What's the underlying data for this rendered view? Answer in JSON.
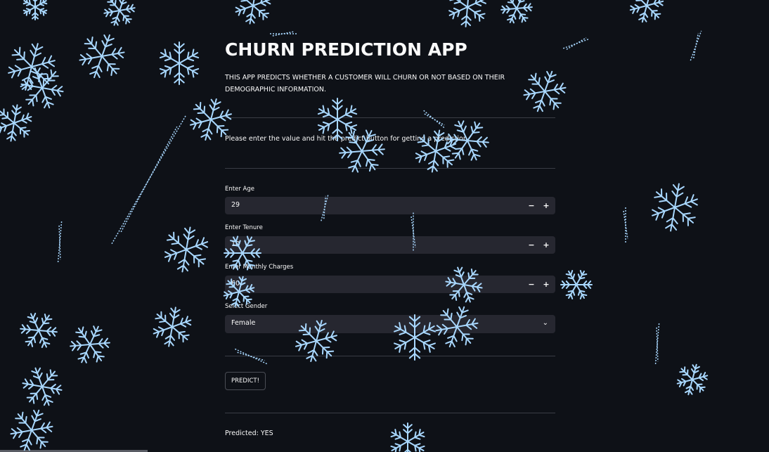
{
  "app": {
    "title": "CHURN PREDICTION APP",
    "subtitle": "THIS APP PREDICTS WHETHER A CUSTOMER WILL CHURN OR NOT BASED ON THEIR DEMOGRAPHIC INFORMATION.",
    "instruction": "Please enter the value and hit the predict button for getting a prediction"
  },
  "form": {
    "age": {
      "label": "Enter Age",
      "value": "29",
      "minus": "−",
      "plus": "+"
    },
    "tenure": {
      "label": "Enter Tenure",
      "value": "10",
      "minus": "−",
      "plus": "+"
    },
    "monthly": {
      "label": "Enter Monthly Charges",
      "value": "60",
      "minus": "−",
      "plus": "+"
    },
    "gender": {
      "label": "Select Gender",
      "value": "Female",
      "chevron": "⌄"
    },
    "predict_label": "PREDICT!"
  },
  "result": "Predicted: YES",
  "colors": {
    "background": "#0e1117",
    "input_bg": "#262730",
    "snowflake": "#a9d8ff",
    "text": "#fafafa"
  },
  "decor": {
    "icon": "snowflake-icon"
  }
}
